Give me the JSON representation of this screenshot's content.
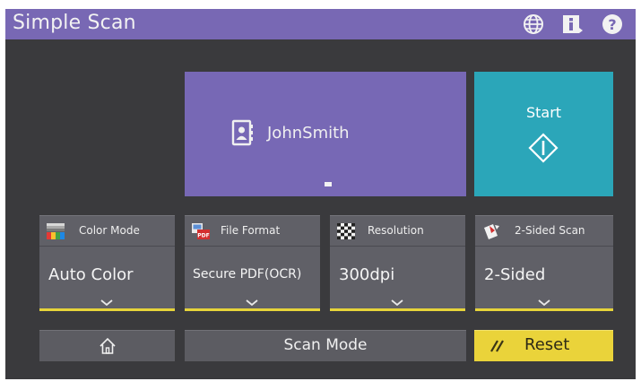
{
  "header": {
    "title": "Simple Scan",
    "icons": [
      "globe-icon",
      "info-icon",
      "help-icon"
    ]
  },
  "destination": {
    "name": "JohnSmith",
    "indicator": "-",
    "icon": "address-book-icon"
  },
  "start": {
    "label": "Start",
    "icon": "start-diamond-icon"
  },
  "settings": [
    {
      "label": "Color Mode",
      "value": "Auto Color",
      "icon": "color-mode-icon"
    },
    {
      "label": "File Format",
      "value": "Secure PDF(OCR)",
      "icon": "file-format-icon"
    },
    {
      "label": "Resolution",
      "value": "300dpi",
      "icon": "resolution-icon"
    },
    {
      "label": "2-Sided Scan",
      "value": "2-Sided",
      "icon": "two-sided-scan-icon"
    }
  ],
  "bottom": {
    "home_icon": "home-icon",
    "scan_mode_label": "Scan Mode",
    "reset_label": "Reset",
    "reset_icon": "eraser-icon"
  },
  "colors": {
    "title_bar": "#7868b4",
    "destination": "#7768b5",
    "start": "#2ba6b9",
    "reset": "#ead33a",
    "card": "#606067",
    "highlight_bar": "#e6d43a"
  }
}
